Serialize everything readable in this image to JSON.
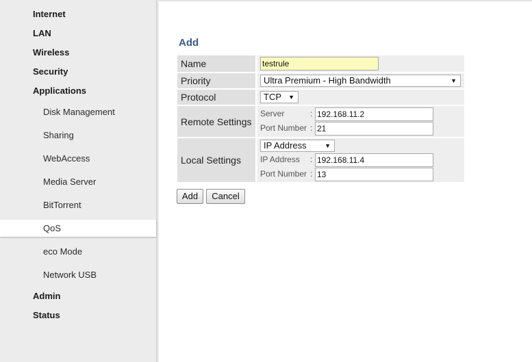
{
  "sidebar": {
    "main_items": [
      "Internet",
      "LAN",
      "Wireless",
      "Security",
      "Applications"
    ],
    "app_items": [
      "Disk Management",
      "Sharing",
      "WebAccess",
      "Media Server",
      "BitTorrent",
      "QoS",
      "eco Mode",
      "Network USB"
    ],
    "bottom_items": [
      "Admin",
      "Status"
    ],
    "active": "QoS"
  },
  "form": {
    "title": "Add",
    "name_label": "Name",
    "name_value": "testrule",
    "priority_label": "Priority",
    "priority_value": "Ultra Premium - High Bandwidth",
    "protocol_label": "Protocol",
    "protocol_value": "TCP",
    "remote_label": "Remote Settings",
    "remote_server_label": "Server",
    "remote_server_value": "192.168.11.2",
    "remote_port_label": "Port Number",
    "remote_port_value": "21",
    "local_label": "Local Settings",
    "local_type_value": "IP Address",
    "local_ip_label": "IP Address",
    "local_ip_value": "192.168.11.4",
    "local_port_label": "Port Number",
    "local_port_value": "13",
    "colon": ":"
  },
  "buttons": {
    "add": "Add",
    "cancel": "Cancel"
  },
  "colors": {
    "title": "#3a5a8c",
    "name_field_bg": "#fbfbbd"
  }
}
